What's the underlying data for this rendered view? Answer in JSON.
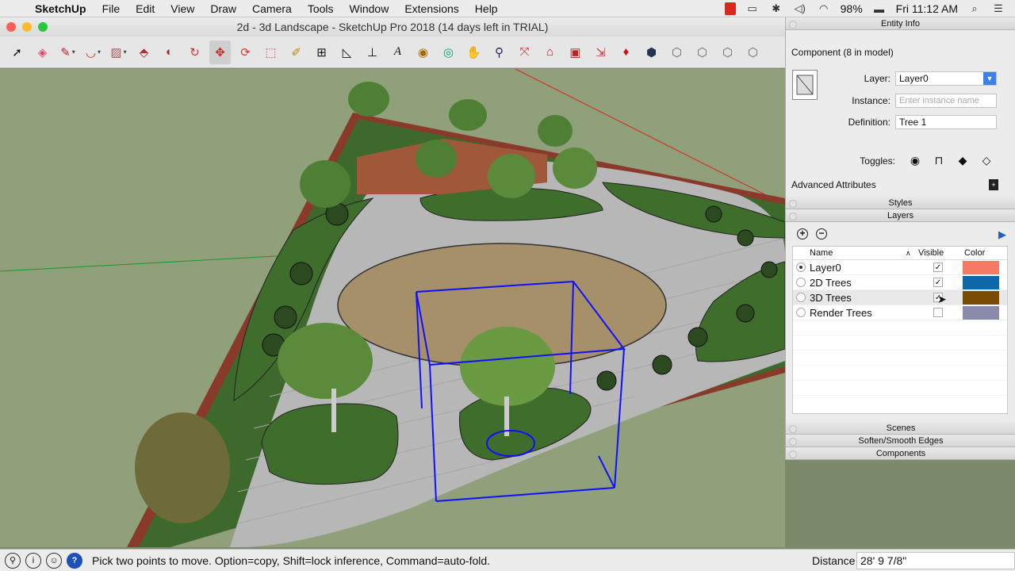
{
  "menubar": {
    "app": "SketchUp",
    "items": [
      "File",
      "Edit",
      "View",
      "Draw",
      "Camera",
      "Tools",
      "Window",
      "Extensions",
      "Help"
    ],
    "battery": "98%",
    "clock": "Fri 11:12 AM"
  },
  "window": {
    "title": "2d - 3d Landscape - SketchUp Pro 2018 (14 days left in TRIAL)"
  },
  "toolbar": {
    "tools": [
      "select-icon",
      "eraser-icon",
      "line-icon",
      "arc-icon",
      "rectangle-icon",
      "push-pull-icon",
      "offset-icon",
      "follow-me-icon",
      "move-icon",
      "rotate-icon",
      "scale-icon",
      "tape-measure-icon",
      "dimension-icon",
      "protractor-icon",
      "axes-icon",
      "text-icon",
      "paint-bucket-icon",
      "orbit-icon",
      "pan-icon",
      "zoom-icon",
      "zoom-extents-icon",
      "warehouse-icon",
      "extension-warehouse-icon",
      "send-to-layout-icon",
      "ruby-icon",
      "iso-view-icon",
      "top-view-icon",
      "front-view-icon",
      "right-view-icon",
      "back-view-icon"
    ],
    "selected": "move-icon"
  },
  "entity_info": {
    "header": "Entity Info",
    "title": "Component (8 in model)",
    "layer_label": "Layer:",
    "layer_value": "Layer0",
    "instance_label": "Instance:",
    "instance_placeholder": "Enter instance name",
    "definition_label": "Definition:",
    "definition_value": "Tree 1",
    "toggles_label": "Toggles:",
    "advanced_label": "Advanced Attributes"
  },
  "styles_header": "Styles",
  "layers": {
    "header": "Layers",
    "columns": {
      "name": "Name",
      "visible": "Visible",
      "color": "Color"
    },
    "rows": [
      {
        "name": "Layer0",
        "active": true,
        "visible": true,
        "color": "#f47a63"
      },
      {
        "name": "2D Trees",
        "active": false,
        "visible": true,
        "color": "#0c68a8"
      },
      {
        "name": "3D Trees",
        "active": false,
        "visible": true,
        "color": "#7a4b05"
      },
      {
        "name": "Render Trees",
        "active": false,
        "visible": false,
        "color": "#8a8aaa"
      }
    ]
  },
  "tray": {
    "scenes": "Scenes",
    "soften": "Soften/Smooth Edges",
    "components": "Components"
  },
  "status": {
    "message": "Pick two points to move.  Option=copy, Shift=lock inference, Command=auto-fold.",
    "distance_label": "Distance",
    "distance_value": "28' 9 7/8\""
  }
}
